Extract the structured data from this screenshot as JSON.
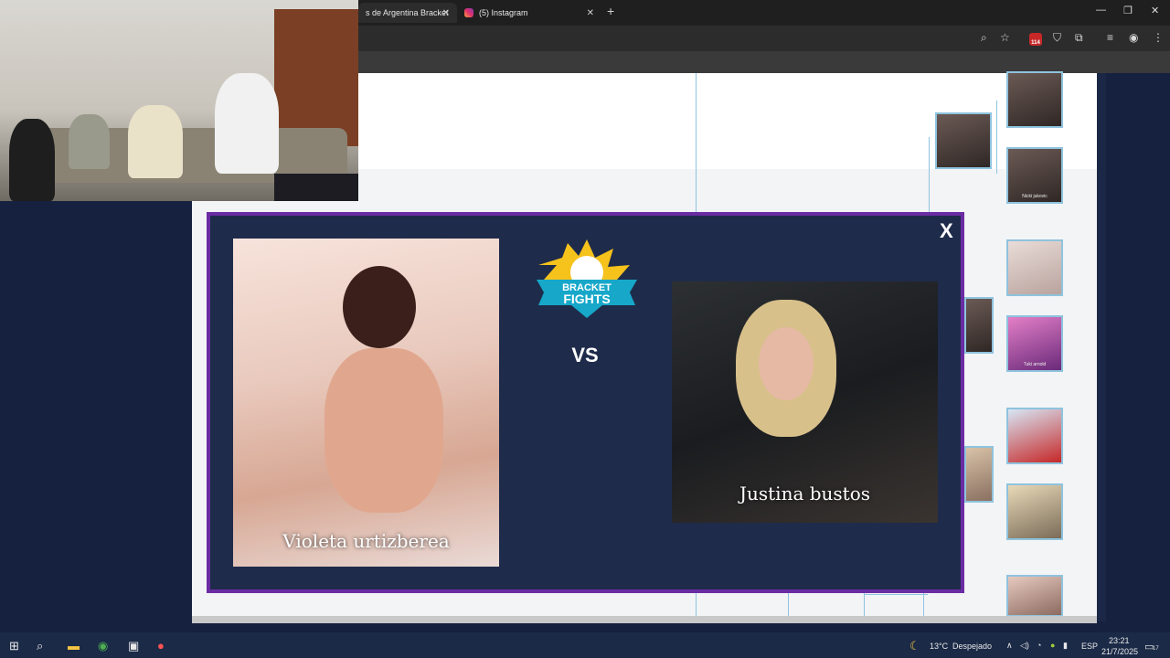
{
  "browser": {
    "tabs": [
      {
        "title": "s de Argentina Bracket",
        "active": true
      },
      {
        "title": "(5) Instagram",
        "active": false
      }
    ],
    "new_tab": "+",
    "window_controls": {
      "minimize": "—",
      "restore": "❐",
      "close": "✕"
    },
    "tab_close": "✕",
    "extension_badge": "114"
  },
  "modal": {
    "close_label": "X",
    "vs_label": "VS",
    "logo_text_line1": "BRACKET",
    "logo_text_line2": "FIGHTS",
    "left_contestant": "Violeta urtizberea",
    "right_contestant": "Justina bustos"
  },
  "bracket": {
    "thumb_labels": [
      "Nicki jukovic",
      "Tuki arnold"
    ]
  },
  "taskbar": {
    "weather_temp": "13°C",
    "weather_desc": "Despejado",
    "language": "ESP",
    "time": "23:21",
    "date": "21/7/2025",
    "notification_count": "17"
  },
  "colors": {
    "modal_bg": "#1f2b4a",
    "modal_border": "#6a2ca3",
    "bracket_line": "#8fc3de",
    "taskbar_bg": "#1b2a47"
  }
}
